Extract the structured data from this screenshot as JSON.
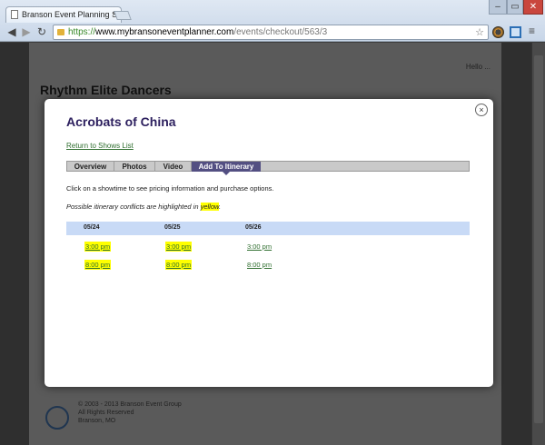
{
  "browser": {
    "tab_title": "Branson Event Planning Sy",
    "tab_close": "×",
    "url_protocol": "https://",
    "url_host": "www.mybransoneventplanner.com",
    "url_path": "/events/checkout/563/3",
    "back": "◀",
    "forward": "▶",
    "reload": "↻",
    "star": "☆",
    "menu": "≡",
    "win_min": "‒",
    "win_max": "▭",
    "win_close": "✕"
  },
  "background": {
    "title": "Rhythm Elite Dancers",
    "login_text": "Hello ...",
    "footer_lines": [
      "© 2003 - 2013 Branson Event Group",
      "All Rights Reserved",
      "Branson, MO"
    ]
  },
  "modal": {
    "close_label": "×",
    "title": "Acrobats of China",
    "return_link": "Return to Shows List",
    "tabs": [
      {
        "label": "Overview",
        "active": false
      },
      {
        "label": "Photos",
        "active": false
      },
      {
        "label": "Video",
        "active": false
      },
      {
        "label": "Add To Itinerary",
        "active": true
      }
    ],
    "instructions": "Click on a showtime to see pricing information and purchase options.",
    "conflict_prefix": "Possible itinerary conflicts are highlighted in",
    "conflict_word": "yellow",
    "conflict_suffix": ".",
    "dates": [
      "05/24",
      "05/25",
      "05/26"
    ],
    "showtimes": [
      [
        {
          "time": "3:00 pm",
          "conflict": true
        },
        {
          "time": "3:00 pm",
          "conflict": true
        },
        {
          "time": "3:00 pm",
          "conflict": false
        }
      ],
      [
        {
          "time": "8:00 pm",
          "conflict": true
        },
        {
          "time": "8:00 pm",
          "conflict": true
        },
        {
          "time": "8:00 pm",
          "conflict": false
        }
      ]
    ],
    "highlight_color": "#ffff00"
  }
}
